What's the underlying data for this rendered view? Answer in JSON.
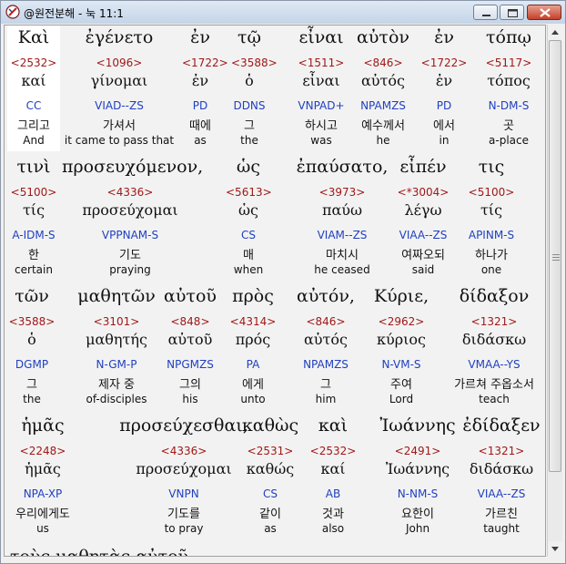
{
  "window": {
    "title": "@원전분해 - 눅 11:1"
  },
  "rows": [
    {
      "words": [
        {
          "greek": "Καὶ",
          "strong": "<2532>",
          "lemma": "καί",
          "parse": "CC",
          "korean": "그리고",
          "english": "And",
          "selected": true
        },
        {
          "greek": "ἐγένετο",
          "strong": "<1096>",
          "lemma": "γίνομαι",
          "parse": "VIAD--ZS",
          "korean": "가셔서",
          "english": "it came to pass that"
        },
        {
          "greek": "ἐν",
          "strong": "<1722>",
          "lemma": "ἐν",
          "parse": "PD",
          "korean": "때에",
          "english": "as"
        },
        {
          "greek": "τῷ",
          "strong": "<3588>",
          "lemma": "ὁ",
          "parse": "DDNS",
          "korean": "그",
          "english": "the"
        },
        {
          "greek": "εἶναι",
          "strong": "<1511>",
          "lemma": "εἶναι",
          "parse": "VNPAD+",
          "korean": "하시고",
          "english": "was"
        },
        {
          "greek": "αὐτὸν",
          "strong": "<846>",
          "lemma": "αὐτός",
          "parse": "NPAMZS",
          "korean": "예수께서",
          "english": "he"
        },
        {
          "greek": "ἐν",
          "strong": "<1722>",
          "lemma": "ἐν",
          "parse": "PD",
          "korean": "에서",
          "english": "in"
        },
        {
          "greek": "τόπῳ",
          "strong": "<5117>",
          "lemma": "τόπος",
          "parse": "N-DM-S",
          "korean": "곳",
          "english": "a-place"
        }
      ]
    },
    {
      "words": [
        {
          "greek": "τινὶ",
          "strong": "<5100>",
          "lemma": "τίς",
          "parse": "A-IDM-S",
          "korean": "한",
          "english": "certain"
        },
        {
          "greek": "προσευχόμενον,",
          "strong": "<4336>",
          "lemma": "προσεύχομαι",
          "parse": "VPPNAM-S",
          "korean": "기도",
          "english": "praying"
        },
        {
          "greek": "ὡς",
          "strong": "<5613>",
          "lemma": "ὡς",
          "parse": "CS",
          "korean": "매",
          "english": "when"
        },
        {
          "greek": "ἐπαύσατο,",
          "strong": "<3973>",
          "lemma": "παύω",
          "parse": "VIAM--ZS",
          "korean": "마치시",
          "english": "he ceased"
        },
        {
          "greek": "εἶπέν",
          "strong": "<*3004>",
          "lemma": "λέγω",
          "parse": "VIAA--ZS",
          "korean": "여짜오되",
          "english": "said"
        },
        {
          "greek": "τις",
          "strong": "<5100>",
          "lemma": "τίς",
          "parse": "APINM-S",
          "korean": "하나가",
          "english": "one"
        }
      ]
    },
    {
      "words": [
        {
          "greek": "τῶν",
          "strong": "<3588>",
          "lemma": "ὁ",
          "parse": "DGMP",
          "korean": "그",
          "english": "the"
        },
        {
          "greek": "μαθητῶν",
          "strong": "<3101>",
          "lemma": "μαθητής",
          "parse": "N-GM-P",
          "korean": "제자 중",
          "english": "of-disciples"
        },
        {
          "greek": "αὐτοῦ",
          "strong": "<848>",
          "lemma": "αὐτοῦ",
          "parse": "NPGMZS",
          "korean": "그의",
          "english": "his"
        },
        {
          "greek": "πρὸς",
          "strong": "<4314>",
          "lemma": "πρός",
          "parse": "PA",
          "korean": "에게",
          "english": "unto"
        },
        {
          "greek": "αὐτόν,",
          "strong": "<846>",
          "lemma": "αὐτός",
          "parse": "NPAMZS",
          "korean": "그",
          "english": "him"
        },
        {
          "greek": "Κύριε,",
          "strong": "<2962>",
          "lemma": "κύριος",
          "parse": "N-VM-S",
          "korean": "주여",
          "english": "Lord"
        },
        {
          "greek": "δίδαξον",
          "strong": "<1321>",
          "lemma": "διδάσκω",
          "parse": "VMAA--YS",
          "korean": "가르쳐 주옵소서",
          "english": "teach"
        }
      ]
    },
    {
      "words": [
        {
          "greek": "ἡμᾶς",
          "strong": "<2248>",
          "lemma": "ἡμᾶς",
          "parse": "NPA-XP",
          "korean": "우리에게도",
          "english": "us"
        },
        {
          "greek": "προσεύχεσθαι,",
          "strong": "<4336>",
          "lemma": "προσεύχομαι",
          "parse": "VNPN",
          "korean": "기도를",
          "english": "to pray"
        },
        {
          "greek": "καθὼς",
          "strong": "<2531>",
          "lemma": "καθώς",
          "parse": "CS",
          "korean": "같이",
          "english": "as"
        },
        {
          "greek": "καὶ",
          "strong": "<2532>",
          "lemma": "καί",
          "parse": "AB",
          "korean": "것과",
          "english": "also"
        },
        {
          "greek": "Ἰωάννης",
          "strong": "<2491>",
          "lemma": "Ἰωάννης",
          "parse": "N-NM-S",
          "korean": "요한이",
          "english": "John"
        },
        {
          "greek": "ἐδίδαξεν",
          "strong": "<1321>",
          "lemma": "διδάσκω",
          "parse": "VIAA--ZS",
          "korean": "가르친",
          "english": "taught"
        }
      ]
    }
  ],
  "partial_next_line": "τοὺς μαθητὰς αὐτοῦ",
  "colors": {
    "strong": "#a01818",
    "parse": "#2040c0",
    "text": "#111111",
    "background": "#f2f2f2",
    "selected_background": "#ffffff"
  }
}
